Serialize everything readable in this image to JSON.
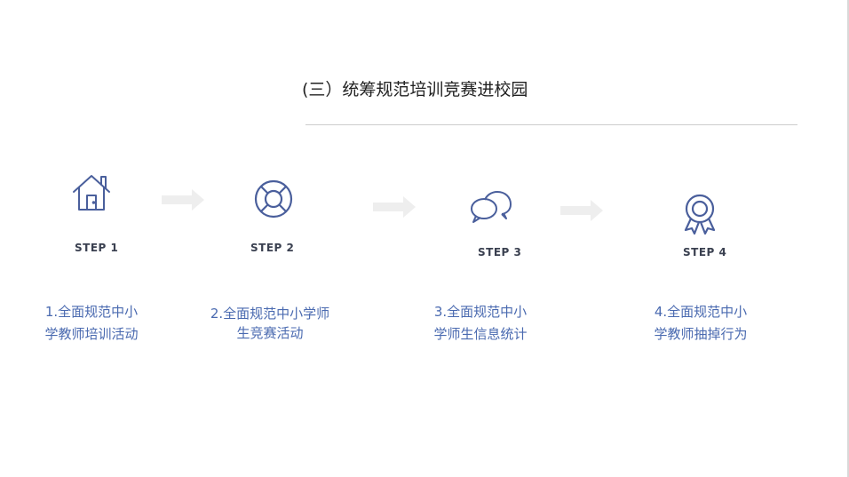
{
  "title": "(三）统筹规范培训竞赛进校园",
  "colors": {
    "icon": "#4a5f9c",
    "text_blue": "#4a6ab0",
    "arrow": "#eeeeee"
  },
  "steps": [
    {
      "icon": "house-icon",
      "label": "STEP 1",
      "line1": "1.全面规范中小",
      "line2": "学教师培训活动"
    },
    {
      "icon": "lifebuoy-icon",
      "label": "STEP 2",
      "line1": "2.全面规范中小学师",
      "line2": "生竞赛活动"
    },
    {
      "icon": "chat-bubbles-icon",
      "label": "STEP 3",
      "line1": "3.全面规范中小",
      "line2": "学师生信息统计"
    },
    {
      "icon": "award-ribbon-icon",
      "label": "STEP 4",
      "line1": "4.全面规范中小",
      "line2": "学教师抽掉行为"
    }
  ]
}
